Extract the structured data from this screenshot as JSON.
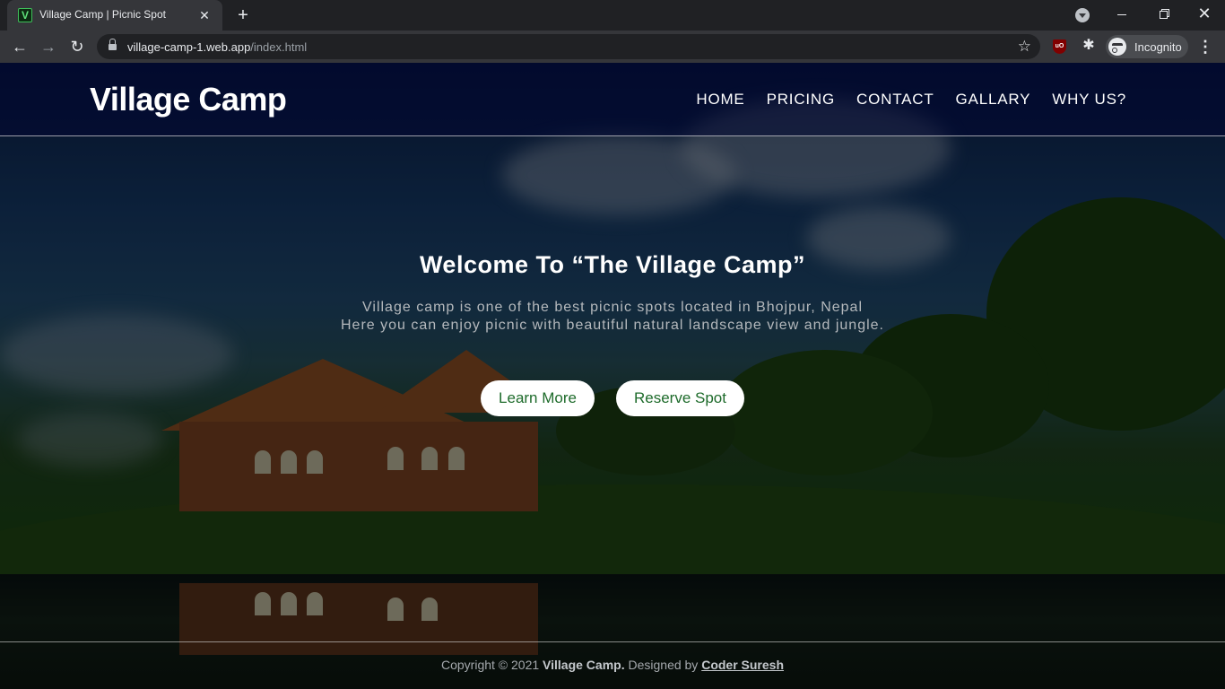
{
  "browser": {
    "tab_title": "Village Camp | Picnic Spot",
    "favicon_letter": "V",
    "url_host": "village-camp-1.web.app",
    "url_path": "/index.html",
    "incognito_label": "Incognito",
    "ublock_badge": "uO"
  },
  "site": {
    "logo": "Village Camp",
    "nav": [
      "HOME",
      "PRICING",
      "CONTACT",
      "GALLARY",
      "WHY US?"
    ],
    "hero": {
      "title_prefix": "Welcome To ",
      "title_strong": "“The Village Camp”",
      "desc_line1": "Village camp is one of the best picnic spots located in Bhojpur, Nepal",
      "desc_line2": "Here you can enjoy picnic with beautiful natural landscape view and jungle."
    },
    "buttons": {
      "learn_more": "Learn More",
      "reserve_spot": "Reserve Spot"
    },
    "footer": {
      "prefix": "Copyright © 2021 ",
      "brand": "Village Camp.",
      "middle": " Designed by ",
      "author": "Coder Suresh"
    }
  },
  "colors": {
    "header_bg": "#000532",
    "button_text": "#1e6b2b",
    "button_bg": "#ffffff"
  }
}
